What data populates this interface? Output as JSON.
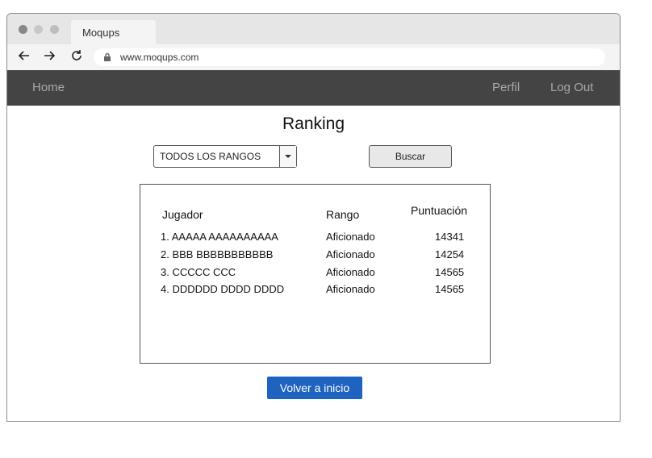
{
  "browser": {
    "tab_title": "Moqups",
    "url": "www.moqups.com",
    "dot_colors": [
      "#888888",
      "#c8c8c8",
      "#bdbdbd"
    ]
  },
  "navbar": {
    "home": "Home",
    "perfil": "Perfil",
    "logout": "Log Out"
  },
  "page": {
    "title": "Ranking",
    "filter_selected": "TODOS LOS RANGOS",
    "search_button": "Buscar",
    "back_button": "Volver a inicio"
  },
  "ranking": {
    "headers": {
      "jugador": "Jugador",
      "rango": "Rango",
      "puntuacion": "Puntuación"
    },
    "rows": [
      {
        "jugador": "1. AAAAA AAAAAAAAAA",
        "rango": "Aficionado",
        "puntuacion": "14341"
      },
      {
        "jugador": "2. BBB BBBBBBBBBBB",
        "rango": "Aficionado",
        "puntuacion": "14254"
      },
      {
        "jugador": "3. CCCCC CCC",
        "rango": "Aficionado",
        "puntuacion": "14565"
      },
      {
        "jugador": "4. DDDDDD DDDD DDDD",
        "rango": "Aficionado",
        "puntuacion": "14565"
      }
    ]
  },
  "colors": {
    "navbar_bg": "#444444",
    "primary_button": "#1e63bf"
  }
}
